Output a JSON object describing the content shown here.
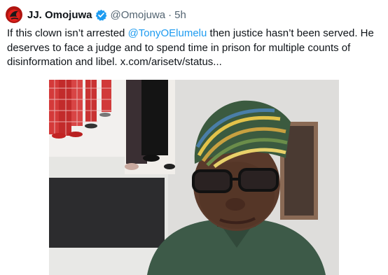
{
  "author": {
    "name": "JJ. Omojuwa",
    "handle": "@Omojuwa",
    "separator": "·",
    "time": "5h",
    "verified": true,
    "avatar_icon": "avatar-logo-icon",
    "verified_icon": "verified-badge-icon"
  },
  "tweet": {
    "text_part1": "If this clown isn’t arrested ",
    "mention": "@TonyOElumelu",
    "text_part2": " then justice hasn’t been served. He deserves to face a judge and to spend time in prison for multiple counts of disinformation and libel.  ",
    "link": "x.com/arisetv/status..."
  },
  "colors": {
    "link": "#1d9bf0",
    "text": "#0f1419",
    "secondary": "#536471",
    "verified": "#1d9bf0"
  }
}
